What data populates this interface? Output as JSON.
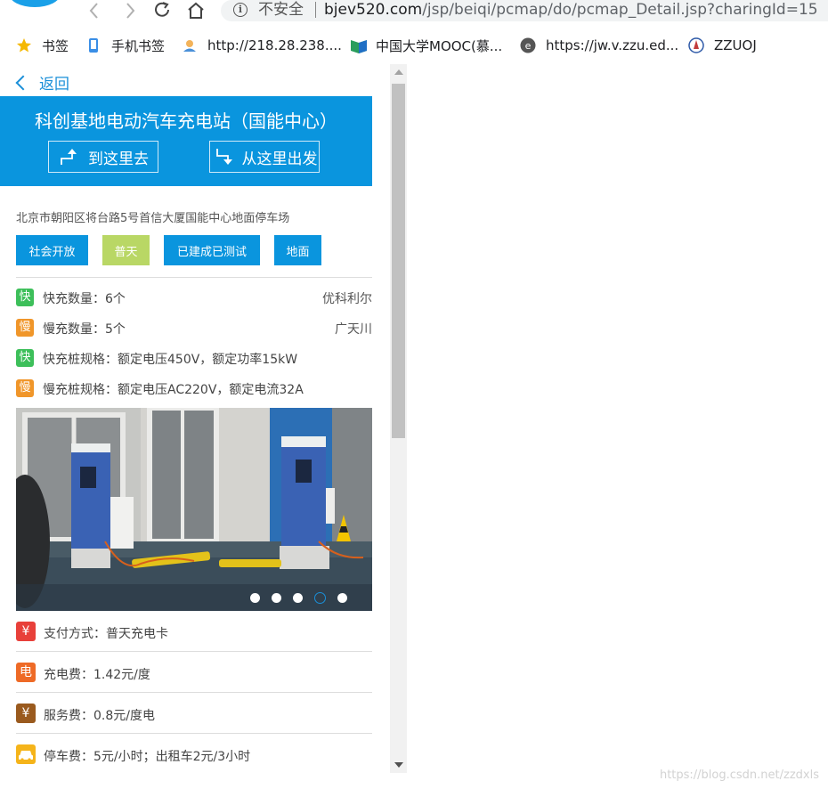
{
  "browser": {
    "security_label": "不安全",
    "url_host": "bjev520.com",
    "url_path": "/jsp/beiqi/pcmap/do/pcmap_Detail.jsp?charingId=15"
  },
  "bookmarks": [
    {
      "label": "书签",
      "icon": "star-icon"
    },
    {
      "label": "手机书签",
      "icon": "phone-icon"
    },
    {
      "label": "http://218.28.238....",
      "icon": "site-icon"
    },
    {
      "label": "中国大学MOOC(慕...",
      "icon": "mooc-icon"
    },
    {
      "label": "https://jw.v.zzu.ed...",
      "icon": "edge-icon"
    },
    {
      "label": "ZZUOJ",
      "icon": "zzu-icon"
    }
  ],
  "page": {
    "back_label": "返回",
    "station_title": "科创基地电动汽车充电站（国能中心）",
    "go_there_label": "到这里去",
    "depart_here_label": "从这里出发",
    "address": "北京市朝阳区将台路5号首信大厦国能中心地面停车场",
    "tags": [
      {
        "label": "社会开放",
        "color": "#0a95de"
      },
      {
        "label": "普天",
        "color": "#b9d765"
      },
      {
        "label": "已建成已测试",
        "color": "#0a95de"
      },
      {
        "label": "地面",
        "color": "#0a95de"
      }
    ],
    "info": {
      "fast_icon": "快",
      "fast_count": "快充数量：6个",
      "fast_brand": "优科利尔",
      "slow_icon": "慢",
      "slow_count": "慢充数量：5个",
      "slow_brand": "广天川",
      "fast_spec_icon": "快",
      "fast_spec": "快充桩规格：额定电压450V，额定功率15kW",
      "slow_spec_icon": "慢",
      "slow_spec": "慢充桩规格：额定电压AC220V，额定电流32A"
    },
    "carousel": {
      "active_index": 3,
      "count": 5
    },
    "fees": {
      "payment_icon": "¥",
      "payment": "支付方式：普天充电卡",
      "charge_icon": "电",
      "charge_fee": "充电费：1.42元/度",
      "service_icon": "¥",
      "service_fee": "服务费：0.8元/度电",
      "parking_fee": "停车费：5元/小时；出租车2元/3小时"
    }
  },
  "watermark": "https://blog.csdn.net/zzdxls",
  "colors": {
    "accent": "#0a95de",
    "green": "#3dbf5a",
    "orange": "#f0962a",
    "red": "#e8403a"
  }
}
